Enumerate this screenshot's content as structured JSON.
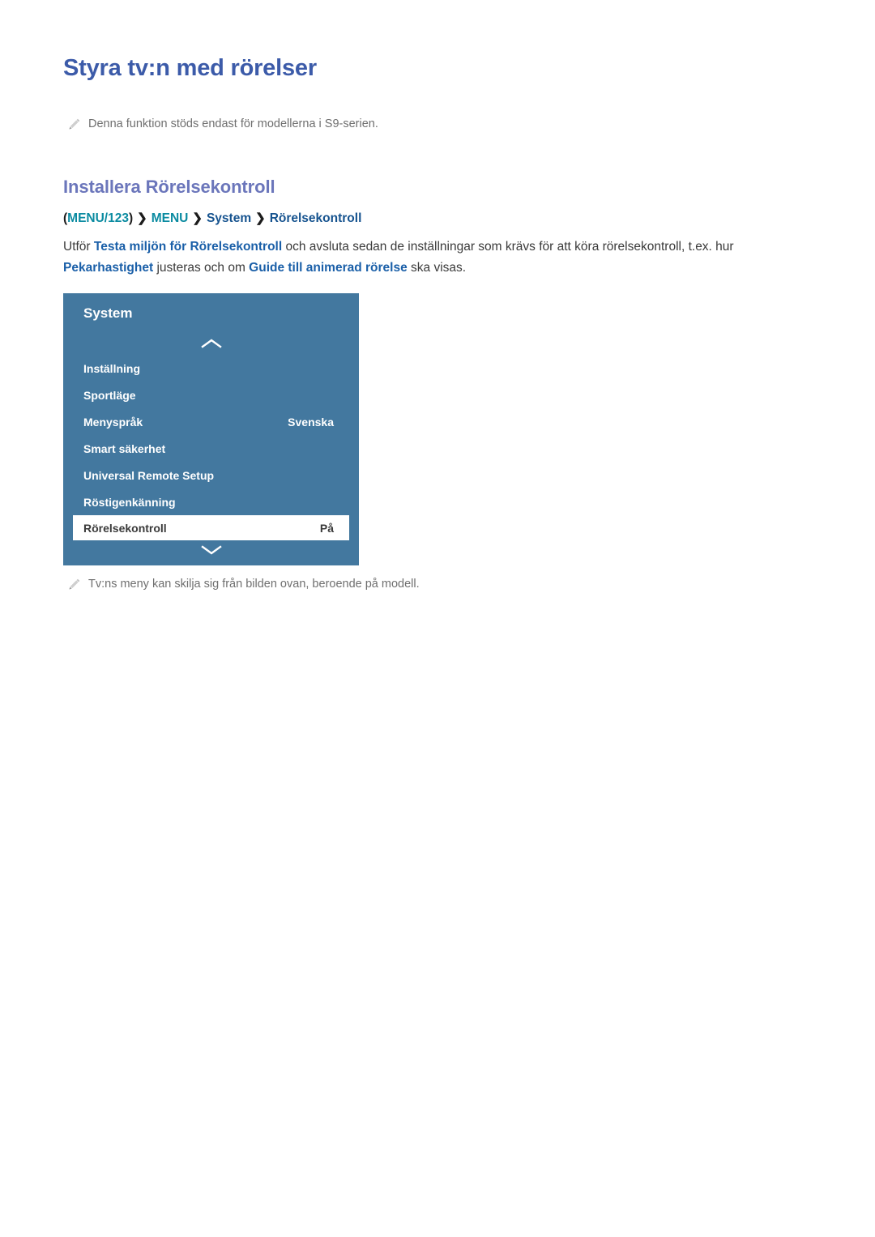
{
  "page": {
    "title": "Styra tv:n med rörelser"
  },
  "notes": [
    {
      "icon": "pencil-icon",
      "text": "Denna funktion stöds endast för modellerna i S9-serien."
    },
    {
      "icon": "pencil-icon",
      "text": "Tv:ns meny kan skilja sig från bilden ovan, beroende på modell."
    }
  ],
  "section": {
    "heading": "Installera Rörelsekontroll",
    "breadcrumb": {
      "open_paren": "(",
      "item1": "MENU/123",
      "close_paren": ")",
      "sep": "❯",
      "item2": "MENU",
      "item3": "System",
      "item4": "Rörelsekontroll"
    },
    "paragraph": {
      "t1": "Utför ",
      "b1": "Testa miljön för Rörelsekontroll",
      "t2": " och avsluta sedan de inställningar som krävs för att köra rörelsekontroll, t.ex. hur ",
      "b2": "Pekarhastighet",
      "t3": " justeras och om ",
      "b3": "Guide till animerad rörelse",
      "t4": " ska visas."
    }
  },
  "tv_menu": {
    "title": "System",
    "scroll_up_icon": "chevron-up-icon",
    "scroll_down_icon": "chevron-down-icon",
    "items": [
      {
        "label": "Inställning",
        "value": "",
        "selected": false
      },
      {
        "label": "Sportläge",
        "value": "",
        "selected": false
      },
      {
        "label": "Menyspråk",
        "value": "Svenska",
        "selected": false
      },
      {
        "label": "Smart säkerhet",
        "value": "",
        "selected": false
      },
      {
        "label": "Universal Remote Setup",
        "value": "",
        "selected": false
      },
      {
        "label": "Röstigenkänning",
        "value": "",
        "selected": false
      },
      {
        "label": "Rörelsekontroll",
        "value": "På",
        "selected": true
      }
    ]
  },
  "colors": {
    "h1": "#3c5ba9",
    "h2": "#6b76bb",
    "breadcrumb_teal": "#0b8ba1",
    "breadcrumb_navy": "#16538f",
    "body_bold": "#1a5fa8",
    "body_text": "#3a3a3a",
    "note_text": "#6f6f6f",
    "panel_bg": "#43789f",
    "panel_selected_bg": "#ffffff"
  }
}
